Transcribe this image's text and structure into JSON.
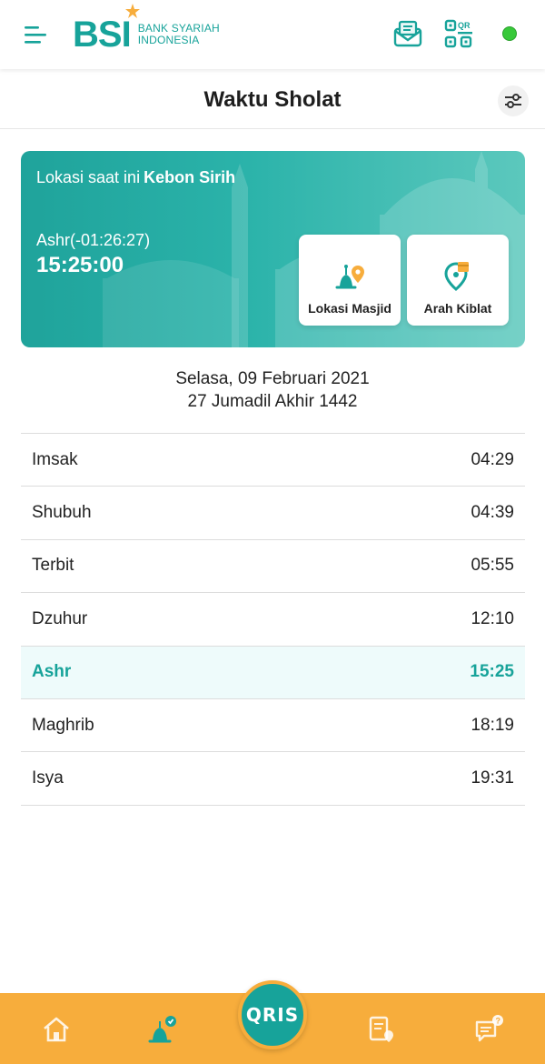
{
  "header": {
    "logo_mark": "BSI",
    "logo_line1": "BANK SYARIAH",
    "logo_line2": "INDONESIA",
    "icons": [
      "menu-icon",
      "mail-icon",
      "qr-icon"
    ],
    "qr_label": "QR",
    "status_color": "#38c93a"
  },
  "page": {
    "title": "Waktu Sholat"
  },
  "banner": {
    "location_prefix": "Lokasi saat ini",
    "location_name": "Kebon Sirih",
    "countdown": "Ashr(-01:26:27)",
    "current_time": "15:25:00",
    "tiles": [
      {
        "label": "Lokasi Masjid",
        "icon": "mosque-location-icon"
      },
      {
        "label": "Arah Kiblat",
        "icon": "qibla-direction-icon"
      }
    ]
  },
  "dates": {
    "gregorian": "Selasa, 09 Februari 2021",
    "hijri": "27 Jumadil Akhir 1442"
  },
  "prayers": [
    {
      "name": "Imsak",
      "time": "04:29",
      "active": false
    },
    {
      "name": "Shubuh",
      "time": "04:39",
      "active": false
    },
    {
      "name": "Terbit",
      "time": "05:55",
      "active": false
    },
    {
      "name": "Dzuhur",
      "time": "12:10",
      "active": false
    },
    {
      "name": "Ashr",
      "time": "15:25",
      "active": true
    },
    {
      "name": "Maghrib",
      "time": "18:19",
      "active": false
    },
    {
      "name": "Isya",
      "time": "19:31",
      "active": false
    }
  ],
  "bottom_nav": {
    "qris_label": "QRIS",
    "items": [
      "home-icon",
      "prayer-icon",
      "transaction-icon",
      "chat-icon"
    ]
  },
  "colors": {
    "brand_teal": "#17a39a",
    "accent_orange": "#f7ad3c",
    "active_row_bg": "#eefbfb"
  }
}
